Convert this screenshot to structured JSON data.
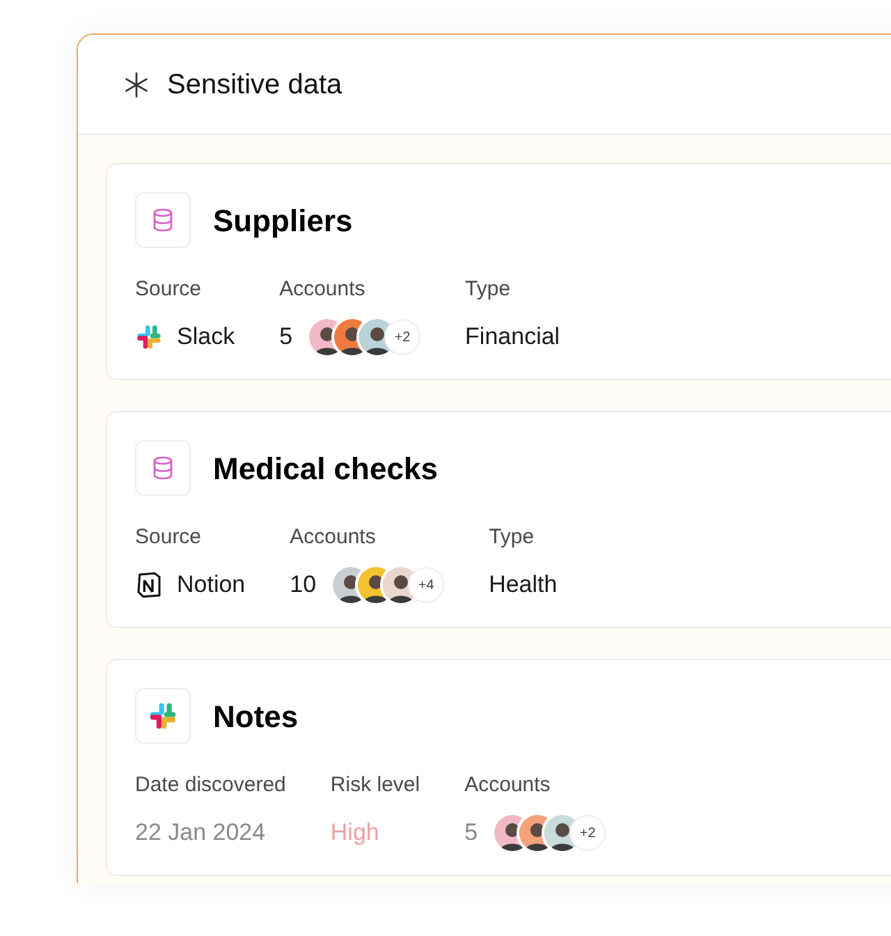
{
  "panel": {
    "title": "Sensitive data"
  },
  "cards": [
    {
      "title": "Suppliers",
      "kind": "database",
      "muted": false,
      "fields": [
        {
          "kind": "source",
          "label": "Source",
          "value": "Slack",
          "logo": {
            "kind": "slack"
          }
        },
        {
          "kind": "accounts",
          "label": "Accounts",
          "value": "5",
          "avatars": [
            {
              "color": "#f2b8c6"
            },
            {
              "color": "#f07b3f"
            },
            {
              "color": "#b9d4d8"
            }
          ],
          "more": "+2"
        },
        {
          "kind": "text",
          "label": "Type",
          "value": "Financial"
        }
      ]
    },
    {
      "title": "Medical checks",
      "kind": "database",
      "muted": false,
      "fields": [
        {
          "kind": "source",
          "label": "Source",
          "value": "Notion",
          "logo": {
            "kind": "notion"
          }
        },
        {
          "kind": "accounts",
          "label": "Accounts",
          "value": "10",
          "avatars": [
            {
              "color": "#c9ced3"
            },
            {
              "color": "#f2c230"
            },
            {
              "color": "#e9d7cf"
            }
          ],
          "more": "+4"
        },
        {
          "kind": "text",
          "label": "Type",
          "value": "Health"
        }
      ]
    },
    {
      "title": "Notes",
      "kind": "slack",
      "muted": true,
      "fields": [
        {
          "kind": "text",
          "label": "Date discovered",
          "value": "22 Jan 2024"
        },
        {
          "kind": "risk",
          "label": "Risk level",
          "value": "High",
          "color": "#e9a3a3"
        },
        {
          "kind": "accounts",
          "label": "Accounts",
          "value": "5",
          "avatars": [
            {
              "color": "#f2b8c6"
            },
            {
              "color": "#f3a27a"
            },
            {
              "color": "#c8dcdc"
            }
          ],
          "more": "+2"
        }
      ]
    }
  ]
}
